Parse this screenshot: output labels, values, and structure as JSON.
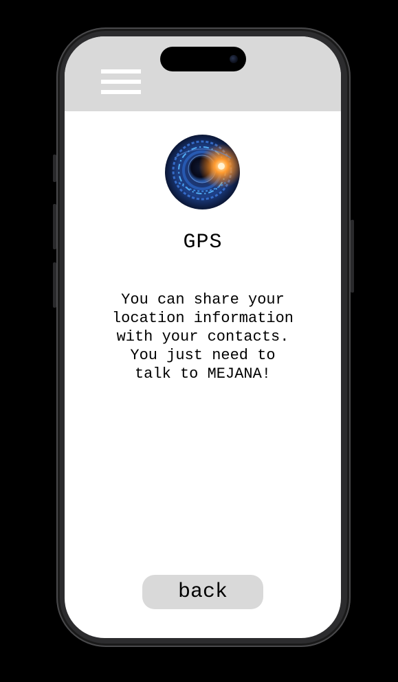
{
  "header": {
    "menu_icon": "hamburger-menu-icon",
    "background_color": "#d9d9d9"
  },
  "feature": {
    "image_icon": "futuristic-eye-lens-image",
    "title": "GPS",
    "description": "You can share your\nlocation information\nwith your contacts.\nYou just need to\ntalk to MEJANA!"
  },
  "footer": {
    "back_label": "back"
  },
  "colors": {
    "background": "#000000",
    "screen": "#ffffff",
    "header": "#d9d9d9",
    "button": "#d9d9d9",
    "text": "#000000"
  }
}
